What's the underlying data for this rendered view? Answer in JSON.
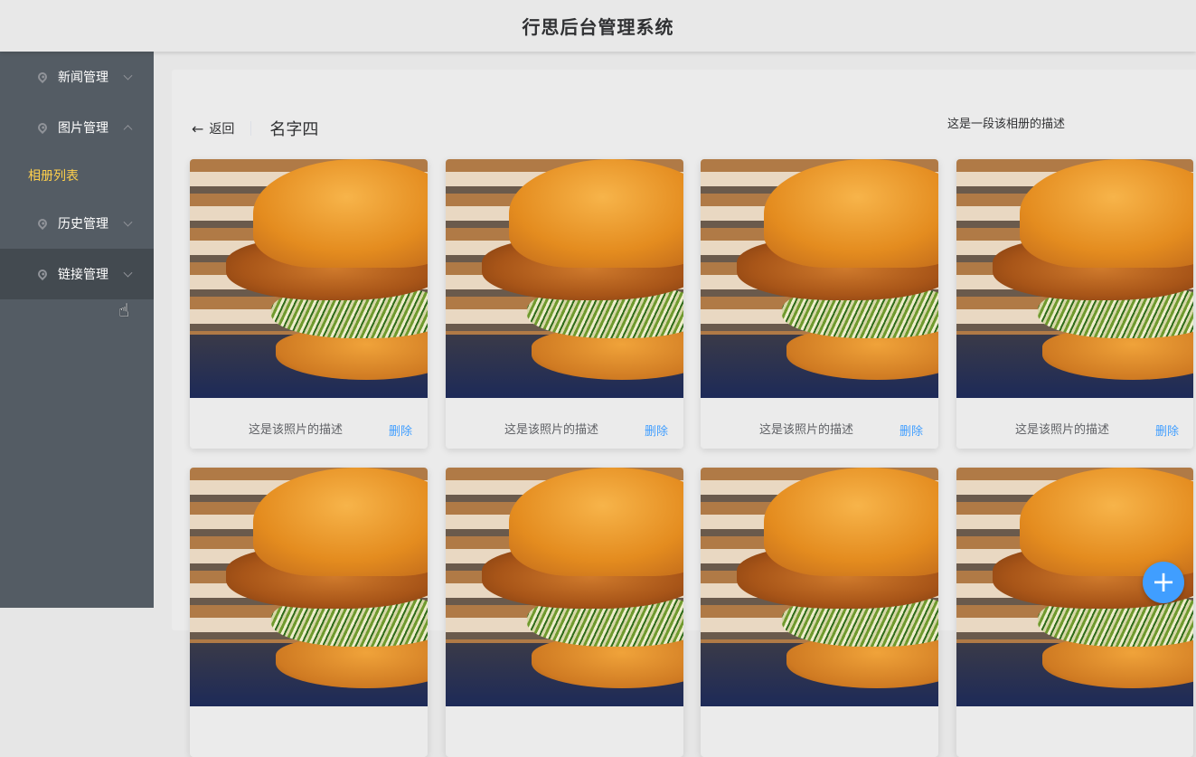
{
  "header": {
    "title": "行思后台管理系统"
  },
  "sidebar": {
    "items": [
      {
        "label": "新闻管理"
      },
      {
        "label": "图片管理"
      },
      {
        "label": "相册列表"
      },
      {
        "label": "历史管理"
      },
      {
        "label": "链接管理"
      }
    ]
  },
  "page": {
    "back_label": "返回",
    "album_name": "名字四",
    "album_description": "这是一段该相册的描述"
  },
  "photos": [
    {
      "description": "这是该照片的描述",
      "delete_label": "删除"
    },
    {
      "description": "这是该照片的描述",
      "delete_label": "删除"
    },
    {
      "description": "这是该照片的描述",
      "delete_label": "删除"
    },
    {
      "description": "这是该照片的描述",
      "delete_label": "删除"
    }
  ],
  "fab": {
    "icon": "plus-icon",
    "label": "+"
  },
  "colors": {
    "accent": "#409eff",
    "sidebar_bg": "#545c64",
    "active_submenu": "#ffd04b"
  }
}
